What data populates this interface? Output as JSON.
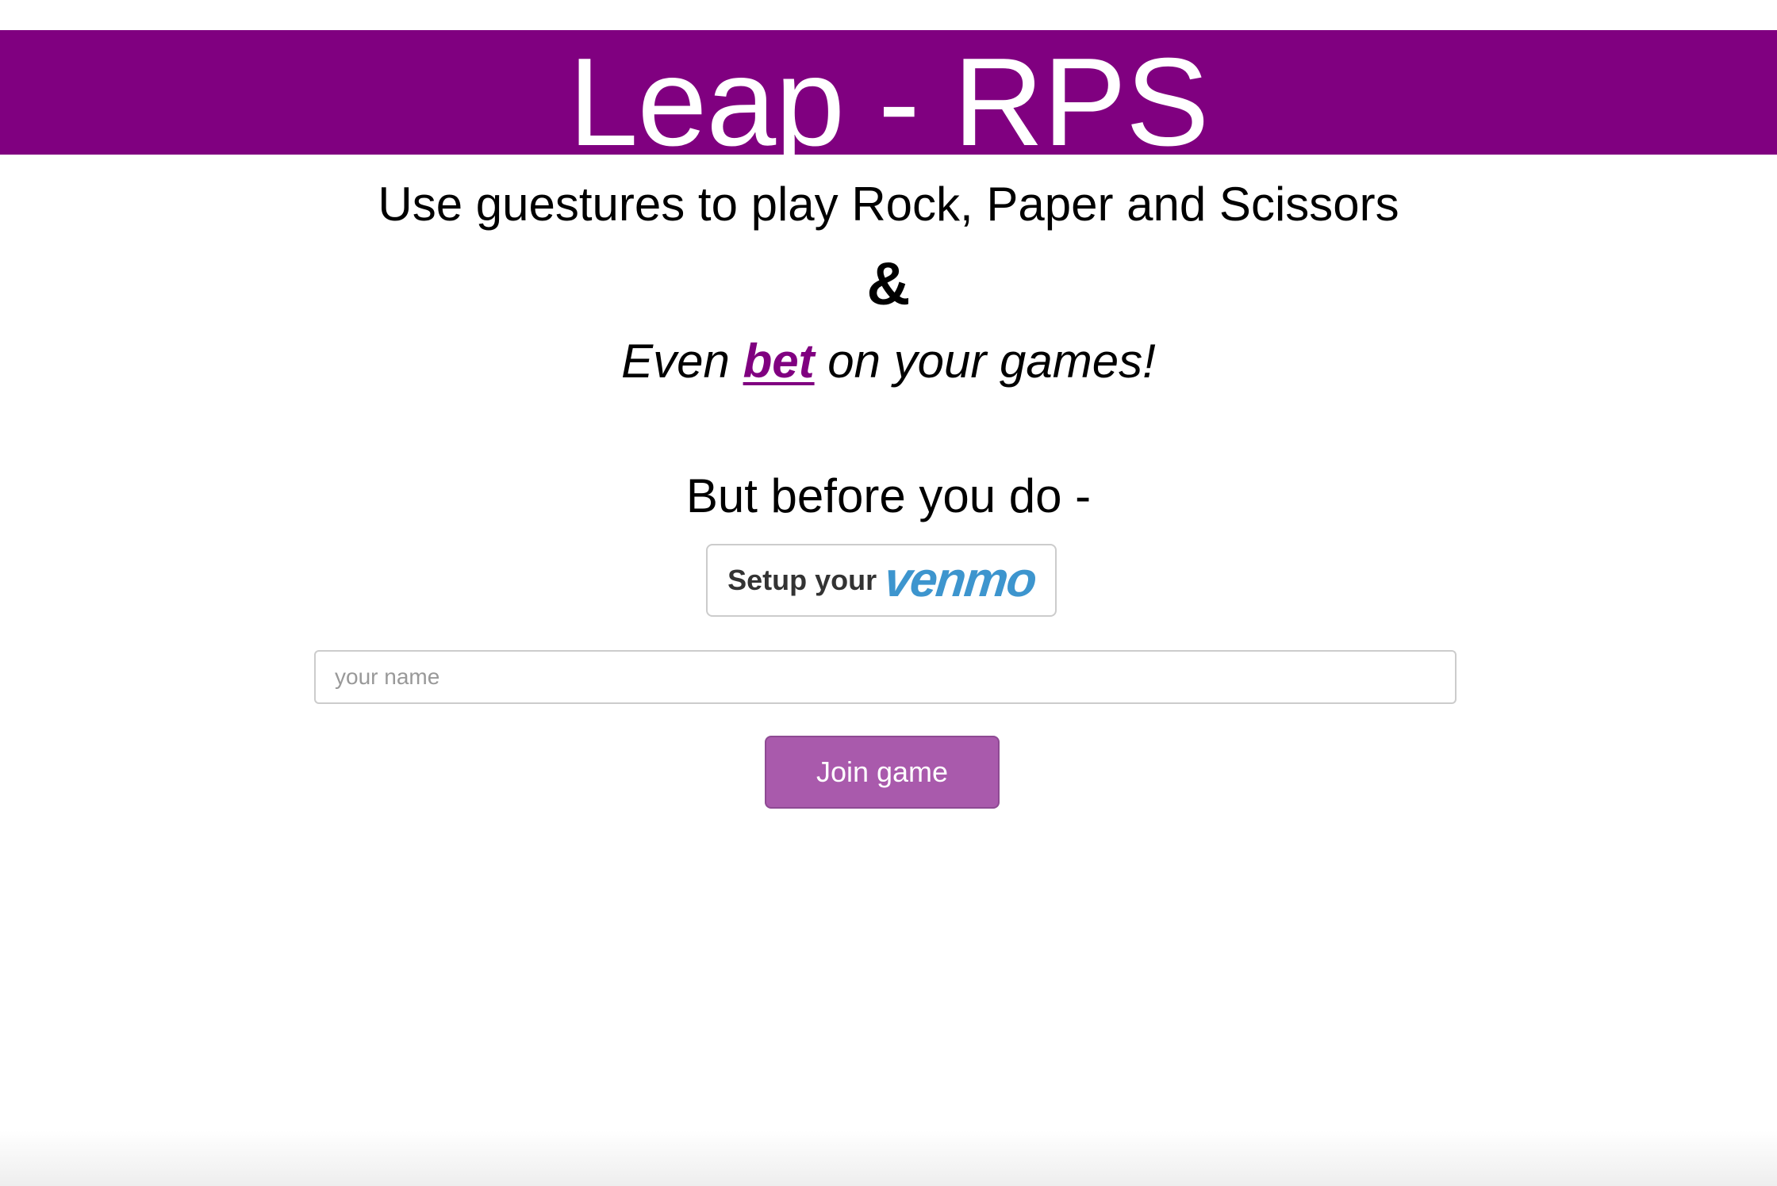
{
  "header": {
    "title": "Leap - RPS",
    "background_color": "#800080"
  },
  "intro": {
    "subtitle": "Use guestures to play Rock, Paper and Scissors",
    "ampersand": "&",
    "tagline_before": "Even ",
    "tagline_link": "bet",
    "tagline_after": " on your games!"
  },
  "setup": {
    "prompt": "But before you do -",
    "venmo_button_label": "Setup your",
    "venmo_brand": "venmo",
    "venmo_brand_color": "#3d95ce"
  },
  "form": {
    "name_placeholder": "your name",
    "name_value": "",
    "join_button_label": "Join game",
    "join_button_color": "#a95aac"
  }
}
